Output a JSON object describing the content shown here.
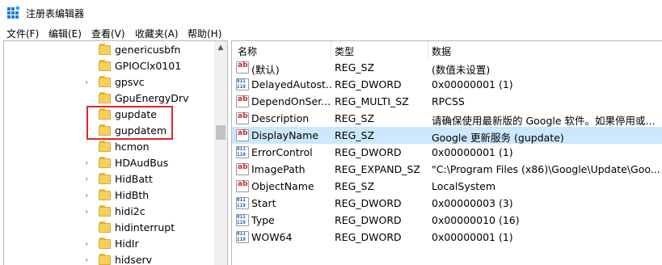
{
  "window": {
    "title": "注册表编辑器"
  },
  "menu": [
    "文件(F)",
    "编辑(E)",
    "查看(V)",
    "收藏夹(A)",
    "帮助(H)"
  ],
  "tree": {
    "items": [
      {
        "label": "genericusbfn",
        "expandable": false
      },
      {
        "label": "GPIOClx0101",
        "expandable": false
      },
      {
        "label": "gpsvc",
        "expandable": true
      },
      {
        "label": "GpuEnergyDrv",
        "expandable": false
      },
      {
        "label": "gupdate",
        "expandable": false,
        "selected": true
      },
      {
        "label": "gupdatem",
        "expandable": false
      },
      {
        "label": "hcmon",
        "expandable": false
      },
      {
        "label": "HDAudBus",
        "expandable": true
      },
      {
        "label": "HidBatt",
        "expandable": true
      },
      {
        "label": "HidBth",
        "expandable": true
      },
      {
        "label": "hidi2c",
        "expandable": true
      },
      {
        "label": "hidinterrupt",
        "expandable": false
      },
      {
        "label": "HidIr",
        "expandable": true
      },
      {
        "label": "hidserv",
        "expandable": true
      }
    ],
    "highlighted": [
      "gupdate",
      "gupdatem"
    ]
  },
  "columns": {
    "name": "名称",
    "type": "类型",
    "data": "数据"
  },
  "values": [
    {
      "icon": "string-value-icon",
      "kind": "sz",
      "name": "(默认)",
      "type": "REG_SZ",
      "data": "(数值未设置)"
    },
    {
      "icon": "binary-value-icon",
      "kind": "bin",
      "name": "DelayedAutost...",
      "type": "REG_DWORD",
      "data": "0x00000001 (1)"
    },
    {
      "icon": "string-value-icon",
      "kind": "sz",
      "name": "DependOnSer...",
      "type": "REG_MULTI_SZ",
      "data": "RPCSS"
    },
    {
      "icon": "string-value-icon",
      "kind": "sz",
      "name": "Description",
      "type": "REG_SZ",
      "data": "请确保使用最新版的 Google 软件。如果停用或..."
    },
    {
      "icon": "string-value-icon",
      "kind": "sz",
      "name": "DisplayName",
      "type": "REG_SZ",
      "data": "Google 更新服务 (gupdate)",
      "selected": true
    },
    {
      "icon": "binary-value-icon",
      "kind": "bin",
      "name": "ErrorControl",
      "type": "REG_DWORD",
      "data": "0x00000001 (1)"
    },
    {
      "icon": "string-value-icon",
      "kind": "sz",
      "name": "ImagePath",
      "type": "REG_EXPAND_SZ",
      "data": "\"C:\\Program Files (x86)\\Google\\Update\\Goo..."
    },
    {
      "icon": "string-value-icon",
      "kind": "sz",
      "name": "ObjectName",
      "type": "REG_SZ",
      "data": "LocalSystem"
    },
    {
      "icon": "binary-value-icon",
      "kind": "bin",
      "name": "Start",
      "type": "REG_DWORD",
      "data": "0x00000003 (3)"
    },
    {
      "icon": "binary-value-icon",
      "kind": "bin",
      "name": "Type",
      "type": "REG_DWORD",
      "data": "0x00000010 (16)"
    },
    {
      "icon": "binary-value-icon",
      "kind": "bin",
      "name": "WOW64",
      "type": "REG_DWORD",
      "data": "0x00000001 (1)"
    }
  ],
  "icon_glyphs": {
    "sz": "ab",
    "bin": "011\n110"
  },
  "colors": {
    "selection": "#cce8ff",
    "highlight_box": "#e0262b",
    "folder": "#f7cf5c"
  }
}
